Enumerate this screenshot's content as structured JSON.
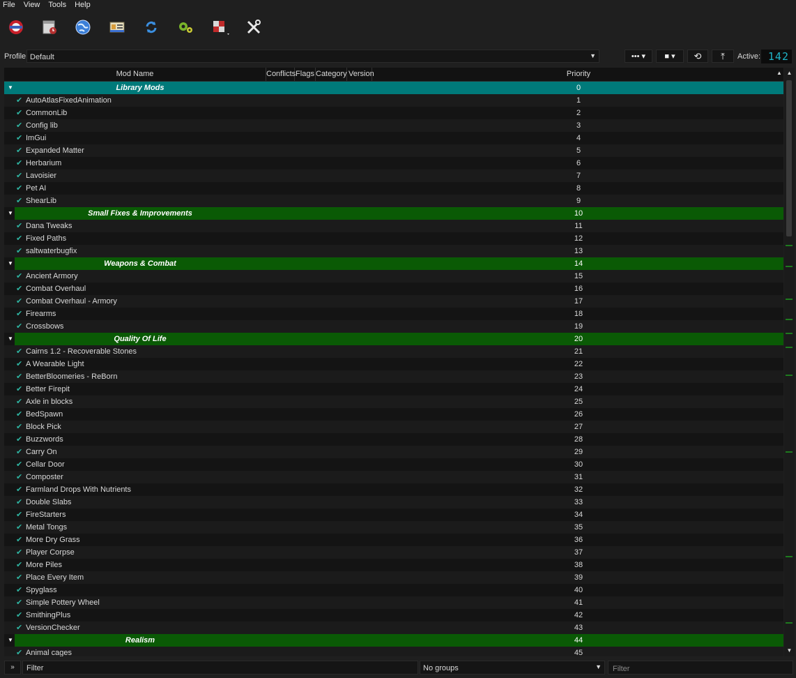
{
  "menu": [
    "File",
    "View",
    "Tools",
    "Help"
  ],
  "toolbar": {
    "icons": [
      "instances-icon",
      "archive-icon",
      "nexus-globe-icon",
      "profiles-icon",
      "refresh-icon",
      "executables-icon",
      "plugins-icon",
      "settings-icon"
    ]
  },
  "profile": {
    "label": "Profile",
    "value": "Default",
    "active_label": "Active:",
    "active_count": "142"
  },
  "table": {
    "columns": {
      "mod_name": "Mod Name",
      "conflicts": "Conflicts",
      "flags": "Flags",
      "category": "Category",
      "version": "Version",
      "priority": "Priority"
    },
    "rows": [
      {
        "type": "group",
        "color": "#007a7a",
        "name": "Library Mods",
        "priority": "0"
      },
      {
        "type": "mod",
        "name": "AutoAtlasFixedAnimation",
        "priority": "1"
      },
      {
        "type": "mod",
        "name": "CommonLib",
        "priority": "2"
      },
      {
        "type": "mod",
        "name": "Config lib",
        "priority": "3"
      },
      {
        "type": "mod",
        "name": "ImGui",
        "priority": "4"
      },
      {
        "type": "mod",
        "name": "Expanded Matter",
        "priority": "5"
      },
      {
        "type": "mod",
        "name": "Herbarium",
        "priority": "6"
      },
      {
        "type": "mod",
        "name": "Lavoisier",
        "priority": "7"
      },
      {
        "type": "mod",
        "name": "Pet AI",
        "priority": "8"
      },
      {
        "type": "mod",
        "name": "ShearLib",
        "priority": "9"
      },
      {
        "type": "group",
        "color": "#0a5a05",
        "name": "Small Fixes & Improvements",
        "priority": "10"
      },
      {
        "type": "mod",
        "name": "Dana Tweaks",
        "priority": "11"
      },
      {
        "type": "mod",
        "name": "Fixed Paths",
        "priority": "12"
      },
      {
        "type": "mod",
        "name": "saltwaterbugfix",
        "priority": "13"
      },
      {
        "type": "group",
        "color": "#0a5a05",
        "name": "Weapons & Combat",
        "priority": "14"
      },
      {
        "type": "mod",
        "name": "Ancient Armory",
        "priority": "15"
      },
      {
        "type": "mod",
        "name": "Combat Overhaul",
        "priority": "16"
      },
      {
        "type": "mod",
        "name": "Combat Overhaul - Armory",
        "priority": "17"
      },
      {
        "type": "mod",
        "name": "Firearms",
        "priority": "18"
      },
      {
        "type": "mod",
        "name": "Crossbows",
        "priority": "19"
      },
      {
        "type": "group",
        "color": "#0a5a05",
        "name": "Quality Of Life",
        "priority": "20"
      },
      {
        "type": "mod",
        "name": "Cairns 1.2 - Recoverable Stones",
        "priority": "21"
      },
      {
        "type": "mod",
        "name": "A Wearable Light",
        "priority": "22"
      },
      {
        "type": "mod",
        "name": "BetterBloomeries - ReBorn",
        "priority": "23"
      },
      {
        "type": "mod",
        "name": "Better Firepit",
        "priority": "24"
      },
      {
        "type": "mod",
        "name": "Axle in blocks",
        "priority": "25"
      },
      {
        "type": "mod",
        "name": "BedSpawn",
        "priority": "26"
      },
      {
        "type": "mod",
        "name": "Block Pick",
        "priority": "27"
      },
      {
        "type": "mod",
        "name": "Buzzwords",
        "priority": "28"
      },
      {
        "type": "mod",
        "name": "Carry On",
        "priority": "29"
      },
      {
        "type": "mod",
        "name": "Cellar Door",
        "priority": "30"
      },
      {
        "type": "mod",
        "name": "Composter",
        "priority": "31"
      },
      {
        "type": "mod",
        "name": "Farmland Drops With Nutrients",
        "priority": "32"
      },
      {
        "type": "mod",
        "name": "Double Slabs",
        "priority": "33"
      },
      {
        "type": "mod",
        "name": "FireStarters",
        "priority": "34"
      },
      {
        "type": "mod",
        "name": "Metal Tongs",
        "priority": "35"
      },
      {
        "type": "mod",
        "name": "More Dry Grass",
        "priority": "36"
      },
      {
        "type": "mod",
        "name": "Player Corpse",
        "priority": "37"
      },
      {
        "type": "mod",
        "name": "More Piles",
        "priority": "38"
      },
      {
        "type": "mod",
        "name": "Place Every Item",
        "priority": "39"
      },
      {
        "type": "mod",
        "name": "Spyglass",
        "priority": "40"
      },
      {
        "type": "mod",
        "name": "Simple Pottery Wheel",
        "priority": "41"
      },
      {
        "type": "mod",
        "name": "SmithingPlus",
        "priority": "42"
      },
      {
        "type": "mod",
        "name": "VersionChecker",
        "priority": "43"
      },
      {
        "type": "group",
        "color": "#0a5a05",
        "name": "Realism",
        "priority": "44"
      },
      {
        "type": "mod",
        "name": "Animal cages",
        "priority": "45"
      }
    ]
  },
  "bottom": {
    "expand_label": "»",
    "filter_left": "Filter",
    "groups_value": "No groups",
    "filter_right_placeholder": "Filter"
  }
}
